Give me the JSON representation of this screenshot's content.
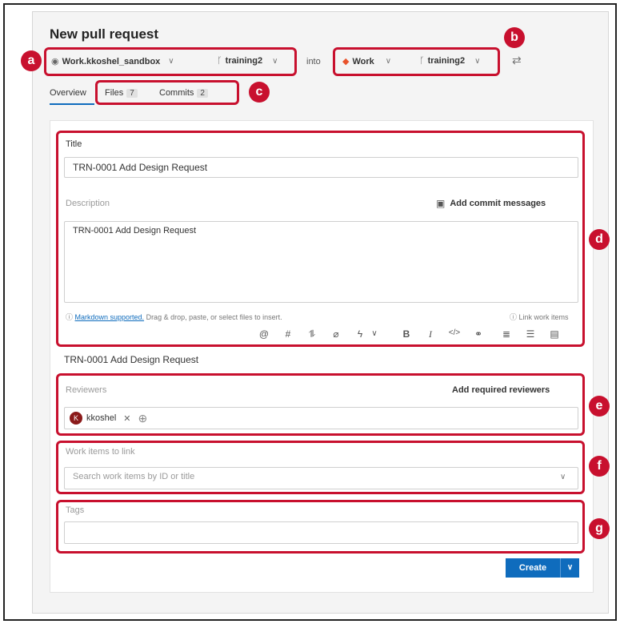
{
  "page": {
    "title": "New pull request"
  },
  "source": {
    "repo": "Work.kkoshel_sandbox",
    "branch": "training2"
  },
  "connector": "into",
  "target": {
    "repo": "Work",
    "branch": "training2"
  },
  "tabs": [
    {
      "label": "Overview"
    },
    {
      "label": "Files",
      "count": "7"
    },
    {
      "label": "Commits",
      "count": "2"
    }
  ],
  "form": {
    "title_label": "Title",
    "title_value": "TRN-0001 Add Design Request",
    "description_label": "Description",
    "add_commit_messages": "Add commit messages",
    "description_value": "TRN-0001 Add Design Request",
    "markdown_link": "Markdown supported.",
    "markdown_hint": " Drag & drop, paste, or select files to insert.",
    "link_work_items": "Link work items",
    "preview_text": "TRN-0001 Add Design Request",
    "reviewers_label": "Reviewers",
    "add_required_reviewers": "Add required reviewers",
    "reviewer_name": "kkoshel",
    "reviewer_initial": "K",
    "work_items_label": "Work items to link",
    "work_items_placeholder": "Search work items by ID or title",
    "tags_label": "Tags",
    "create_label": "Create"
  },
  "callouts": [
    "a",
    "b",
    "c",
    "d",
    "e",
    "f",
    "g"
  ],
  "colors": {
    "accent": "#0f6cbd",
    "highlight": "#c8102e",
    "repo_icon": "#e8532c"
  }
}
